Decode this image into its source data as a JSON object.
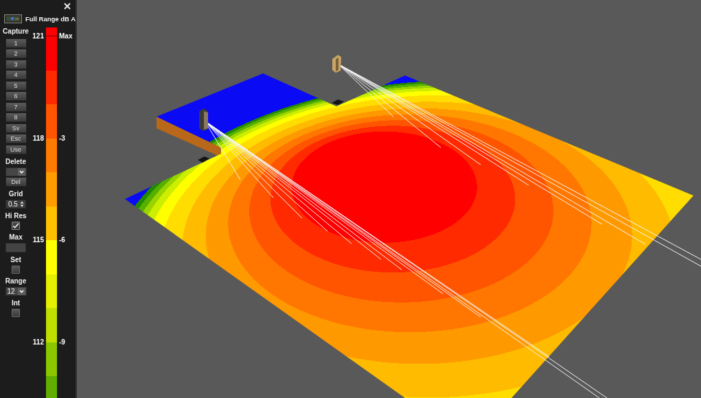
{
  "panel": {
    "title": "Full Range dB A",
    "controls": [
      {
        "kind": "heading",
        "text": "Capture"
      },
      {
        "kind": "button",
        "text": "1"
      },
      {
        "kind": "button",
        "text": "2"
      },
      {
        "kind": "button",
        "text": "3"
      },
      {
        "kind": "button",
        "text": "4"
      },
      {
        "kind": "button",
        "text": "5"
      },
      {
        "kind": "button",
        "text": "6"
      },
      {
        "kind": "button",
        "text": "7"
      },
      {
        "kind": "button",
        "text": "8"
      },
      {
        "kind": "button",
        "text": "Sv"
      },
      {
        "kind": "button",
        "text": "Esc"
      },
      {
        "kind": "button",
        "text": "Use"
      },
      {
        "kind": "heading",
        "text": "Delete"
      },
      {
        "kind": "dropdown"
      },
      {
        "kind": "button",
        "text": "Del"
      },
      {
        "kind": "heading",
        "text": "Grid"
      },
      {
        "kind": "spinner",
        "value": "0.5"
      },
      {
        "kind": "heading",
        "text": "Hi Res"
      },
      {
        "kind": "checkbox",
        "checked": true
      },
      {
        "kind": "heading",
        "text": "Max"
      },
      {
        "kind": "field"
      },
      {
        "kind": "heading",
        "text": "Set"
      },
      {
        "kind": "checkbox",
        "checked": false
      },
      {
        "kind": "heading",
        "text": "Range"
      },
      {
        "kind": "dropdown",
        "value": "12"
      },
      {
        "kind": "heading",
        "text": "Int"
      },
      {
        "kind": "checkbox",
        "checked": false
      }
    ]
  },
  "legend": {
    "bands": [
      {
        "kind": "cap",
        "color": "#ff0000"
      },
      {
        "kind": "step",
        "color": "#ff0000",
        "value": "121",
        "label": "Max"
      },
      {
        "kind": "step",
        "color": "#ff2a00"
      },
      {
        "kind": "step",
        "color": "#ff5500"
      },
      {
        "kind": "step",
        "color": "#ff7a00",
        "value": "118",
        "label": "-3"
      },
      {
        "kind": "step",
        "color": "#ff9c00"
      },
      {
        "kind": "step",
        "color": "#ffc000"
      },
      {
        "kind": "step",
        "color": "#ffff00",
        "value": "115",
        "label": "-6"
      },
      {
        "kind": "step",
        "color": "#e5f000"
      },
      {
        "kind": "step",
        "color": "#c0de00"
      },
      {
        "kind": "step",
        "color": "#8cc600",
        "value": "112",
        "label": "-9"
      },
      {
        "kind": "step",
        "color": "#62ae00"
      }
    ]
  }
}
